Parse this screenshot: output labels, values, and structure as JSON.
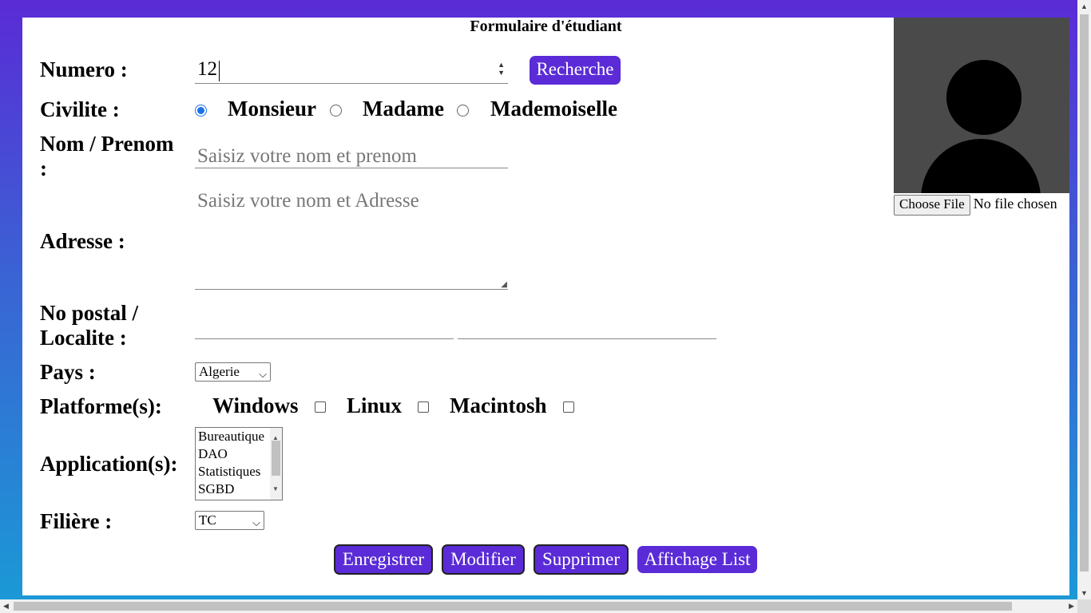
{
  "form_title": "Formulaire d'étudiant",
  "numero": {
    "label": "Numero :",
    "value": "12",
    "search_button": "Recherche"
  },
  "civilite": {
    "label": "Civilite :",
    "options": [
      "Monsieur",
      "Madame",
      "Mademoiselle"
    ],
    "selected": "Monsieur"
  },
  "nom": {
    "label": "Nom / Prenom",
    "label_cont": ":",
    "placeholder": "Saisiz votre nom et prenom"
  },
  "adresse": {
    "label": "Adresse :",
    "placeholder": "Saisiz votre nom et Adresse"
  },
  "postal": {
    "label_line1": "No postal /",
    "label_line2": "Localite :",
    "postal_value": "",
    "localite_value": ""
  },
  "pays": {
    "label": "Pays :",
    "selected": "Algerie"
  },
  "platformes": {
    "label": "Platforme(s):",
    "options": [
      "Windows",
      "Linux",
      "Macintosh"
    ]
  },
  "applications": {
    "label": "Application(s):",
    "items": [
      "Bureautique",
      "DAO",
      "Statistiques",
      "SGBD"
    ]
  },
  "filiere": {
    "label": "Filière :",
    "selected": "TC"
  },
  "actions": {
    "save": "Enregistrer",
    "edit": "Modifier",
    "delete": "Supprimer",
    "list": "Affichage List"
  },
  "photo": {
    "choose_button": "Choose File",
    "status": "No file chosen"
  },
  "colors": {
    "accent": "#5a2bd6",
    "radio_checked": "#1a73e8"
  }
}
